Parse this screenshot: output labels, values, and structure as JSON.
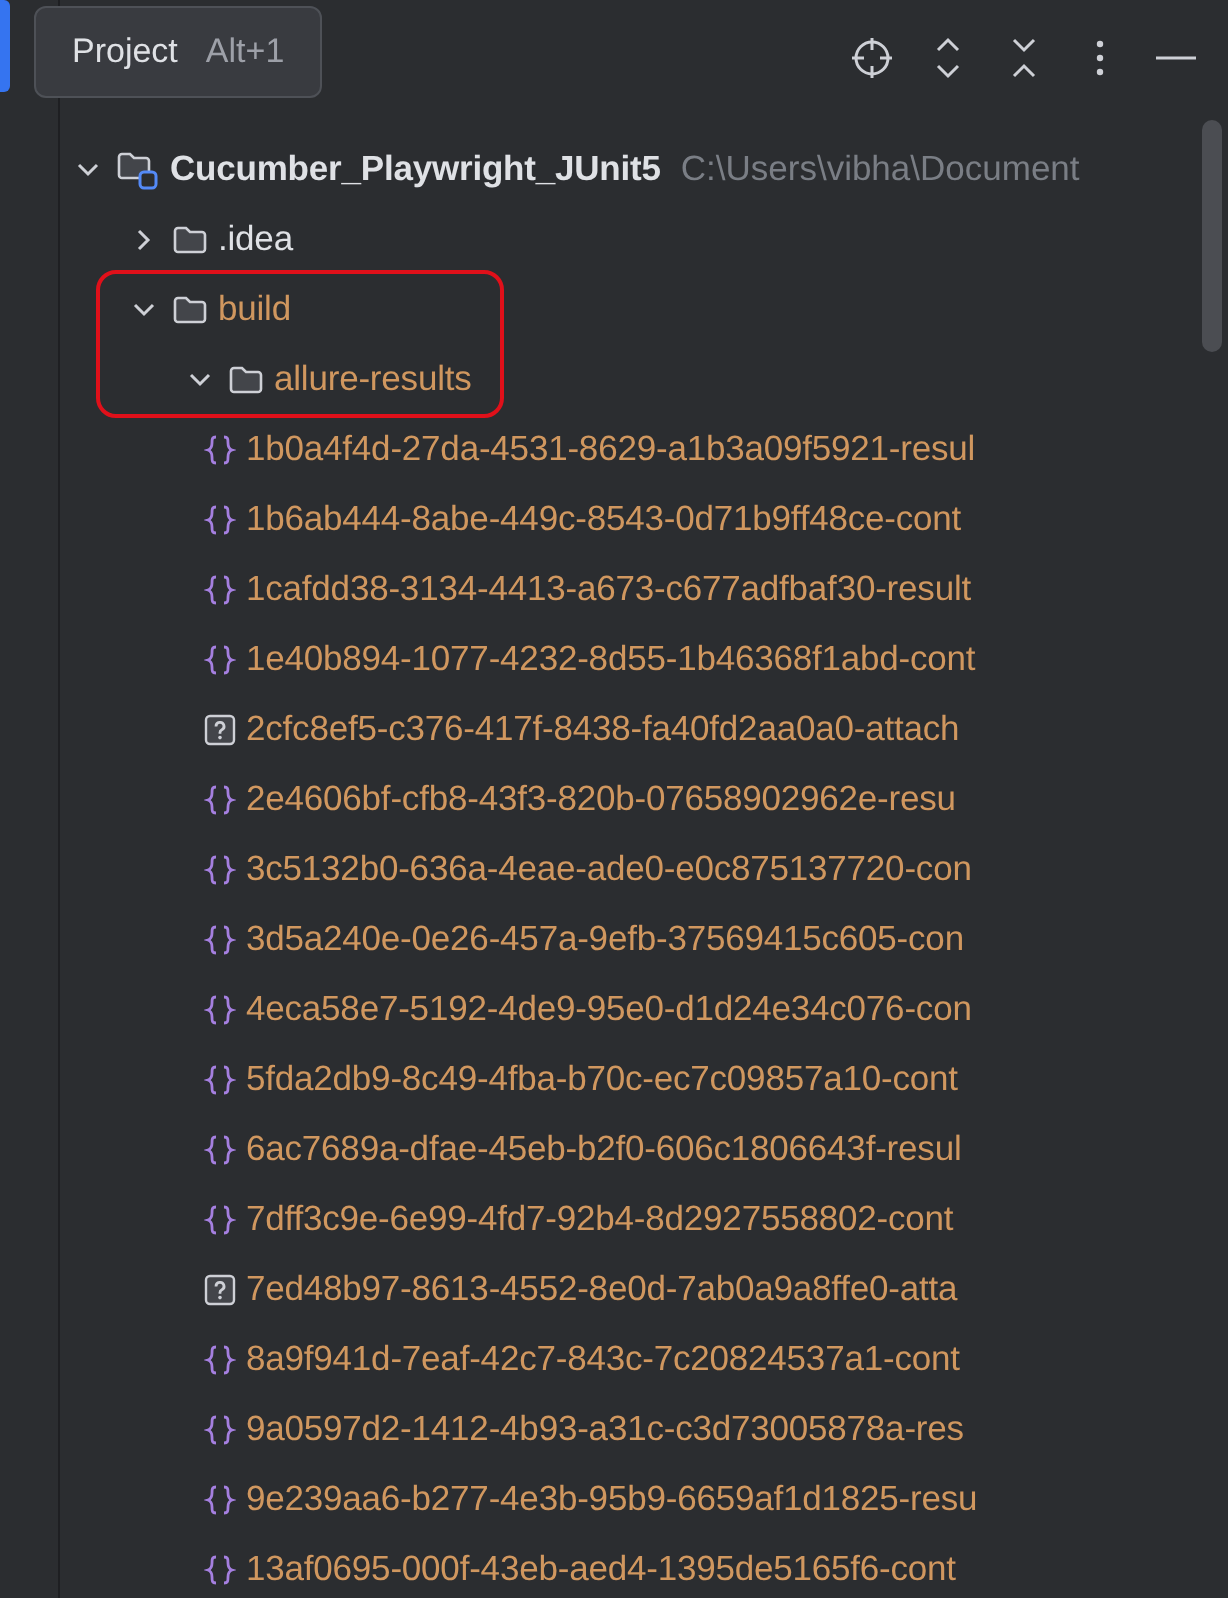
{
  "tooltip": {
    "label": "Project",
    "shortcut": "Alt+1"
  },
  "tree": [
    {
      "label": "Cucumber_Playwright_JUnit5",
      "path": "C:\\Users\\vibha\\Document",
      "kind": "project",
      "expanded": true,
      "children": [
        {
          "label": ".idea",
          "kind": "folder",
          "expanded": false,
          "excluded": false
        },
        {
          "label": "build",
          "kind": "folder",
          "expanded": true,
          "excluded": true,
          "highlighted": true,
          "children": [
            {
              "label": "allure-results",
              "kind": "folder",
              "expanded": true,
              "excluded": true,
              "highlighted": true,
              "children": [
                {
                  "label": "1b0a4f4d-27da-4531-8629-a1b3a09f5921-resul",
                  "kind": "json"
                },
                {
                  "label": "1b6ab444-8abe-449c-8543-0d71b9ff48ce-cont",
                  "kind": "json"
                },
                {
                  "label": "1cafdd38-3134-4413-a673-c677adfbaf30-result",
                  "kind": "json"
                },
                {
                  "label": "1e40b894-1077-4232-8d55-1b46368f1abd-cont",
                  "kind": "json"
                },
                {
                  "label": "2cfc8ef5-c376-417f-8438-fa40fd2aa0a0-attach",
                  "kind": "unknown"
                },
                {
                  "label": "2e4606bf-cfb8-43f3-820b-07658902962e-resu",
                  "kind": "json"
                },
                {
                  "label": "3c5132b0-636a-4eae-ade0-e0c875137720-con",
                  "kind": "json"
                },
                {
                  "label": "3d5a240e-0e26-457a-9efb-37569415c605-con",
                  "kind": "json"
                },
                {
                  "label": "4eca58e7-5192-4de9-95e0-d1d24e34c076-con",
                  "kind": "json"
                },
                {
                  "label": "5fda2db9-8c49-4fba-b70c-ec7c09857a10-cont",
                  "kind": "json"
                },
                {
                  "label": "6ac7689a-dfae-45eb-b2f0-606c1806643f-resul",
                  "kind": "json"
                },
                {
                  "label": "7dff3c9e-6e99-4fd7-92b4-8d2927558802-cont",
                  "kind": "json"
                },
                {
                  "label": "7ed48b97-8613-4552-8e0d-7ab0a9a8ffe0-atta",
                  "kind": "unknown"
                },
                {
                  "label": "8a9f941d-7eaf-42c7-843c-7c20824537a1-cont",
                  "kind": "json"
                },
                {
                  "label": "9a0597d2-1412-4b93-a31c-c3d73005878a-res",
                  "kind": "json"
                },
                {
                  "label": "9e239aa6-b277-4e3b-95b9-6659af1d1825-resu",
                  "kind": "json"
                },
                {
                  "label": "13af0695-000f-43eb-aed4-1395de5165f6-cont",
                  "kind": "json"
                }
              ]
            }
          ]
        }
      ]
    }
  ]
}
